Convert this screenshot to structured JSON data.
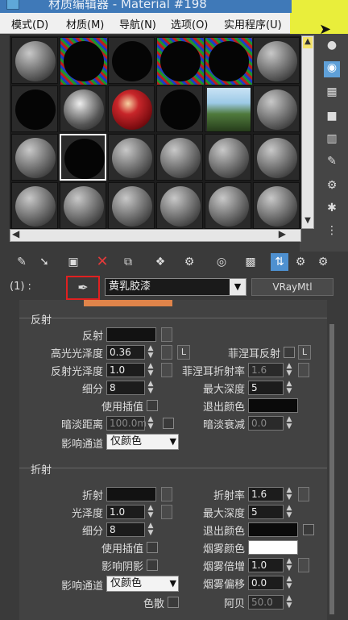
{
  "window": {
    "title": "材质编辑器 - Material #198"
  },
  "menu": [
    "模式(D)",
    "材质(M)",
    "导航(N)",
    "选项(O)",
    "实用程序(U)"
  ],
  "material_slots": [
    {
      "type": "sphere"
    },
    {
      "type": "checker-black"
    },
    {
      "type": "black"
    },
    {
      "type": "checker-black"
    },
    {
      "type": "checker-black"
    },
    {
      "type": "sphere"
    },
    {
      "type": "black"
    },
    {
      "type": "rough"
    },
    {
      "type": "red-pattern"
    },
    {
      "type": "black"
    },
    {
      "type": "tree-thumbnail"
    },
    {
      "type": "sphere"
    },
    {
      "type": "sphere"
    },
    {
      "type": "black-selected"
    },
    {
      "type": "sphere"
    },
    {
      "type": "sphere"
    },
    {
      "type": "sphere"
    },
    {
      "type": "sphere"
    },
    {
      "type": "sphere"
    },
    {
      "type": "sphere"
    },
    {
      "type": "sphere"
    },
    {
      "type": "sphere"
    },
    {
      "type": "sphere"
    },
    {
      "type": "sphere"
    }
  ],
  "name_row": {
    "slot_label": "(1) :",
    "eyedropper_icon": "eyedropper-icon",
    "material_name": "黄乳胶漆",
    "material_type": "VRayMtl"
  },
  "reflection": {
    "section_title": "反射",
    "reflect_label": "反射",
    "hilight_gloss_label": "高光光泽度",
    "hilight_gloss_value": "0.36",
    "lock_btn": "L",
    "fresnel_label": "菲涅耳反射",
    "fresnel_l_btn": "L",
    "refl_gloss_label": "反射光泽度",
    "refl_gloss_value": "1.0",
    "fresnel_ior_label": "菲涅耳折射率",
    "fresnel_ior_value": "1.6",
    "subdivs_label": "细分",
    "subdivs_value": "8",
    "max_depth_label": "最大深度",
    "max_depth_value": "5",
    "use_interp_label": "使用插值",
    "exit_color_label": "退出颜色",
    "dim_distance_label": "暗淡距离",
    "dim_distance_value": "100.0m",
    "dim_falloff_label": "暗淡衰减",
    "dim_falloff_value": "0.0",
    "affect_channels_label": "影响通道",
    "affect_channels_value": "仅颜色"
  },
  "refraction": {
    "section_title": "折射",
    "refract_label": "折射",
    "ior_label": "折射率",
    "ior_value": "1.6",
    "gloss_label": "光泽度",
    "gloss_value": "1.0",
    "max_depth_label": "最大深度",
    "max_depth_value": "5",
    "subdivs_label": "细分",
    "subdivs_value": "8",
    "exit_color_label": "退出颜色",
    "use_interp_label": "使用插值",
    "fog_color_label": "烟雾颜色",
    "affect_shadows_label": "影响阴影",
    "fog_mult_label": "烟雾倍增",
    "fog_mult_value": "1.0",
    "affect_channels_label": "影响通道",
    "affect_channels_value": "仅颜色",
    "fog_bias_label": "烟雾偏移",
    "fog_bias_value": "0.0",
    "dispersion_label": "色散",
    "abbe_label": "阿贝",
    "abbe_value": "50.0"
  },
  "colors": {
    "accent_yellow": "#e9ee3b",
    "highlight_red": "#e02020",
    "titlebar_blue": "#3f79b8",
    "fog_color": "#ffffff",
    "exit_color": "#0a0a0a",
    "diffuse_partial": "#e0844a"
  }
}
